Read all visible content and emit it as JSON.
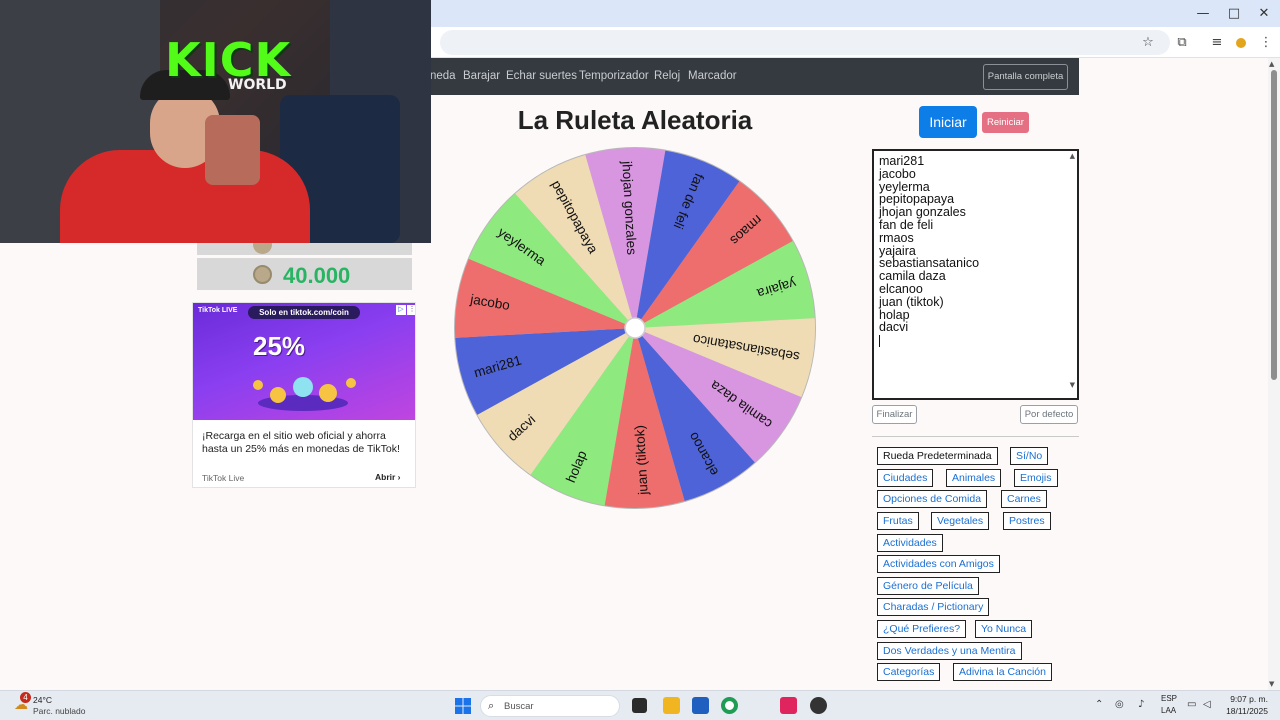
{
  "browser": {
    "window_controls": {
      "minimize": "—",
      "maximize": "□",
      "close": "✕"
    },
    "toolbar_icons": [
      "star-icon",
      "extensions-icon",
      "media-icon",
      "profile-icon",
      "menu-icon"
    ]
  },
  "navbar": {
    "links": [
      "neda",
      "Barajar",
      "Echar suertes",
      "Temporizador",
      "Reloj",
      "Marcador"
    ],
    "fullscreen_label": "Pantalla completa"
  },
  "webcam": {
    "logo_text": "KICK",
    "logo_sub": "WORLD"
  },
  "sidebar_widget": {
    "coin_value": "40.000"
  },
  "ad": {
    "brand": "TikTok LIVE",
    "promo": "Solo en tiktok.com/coin",
    "big_text": "25%",
    "headline": "¡Recarga en el sitio web oficial y ahorra hasta un 25% más en monedas de TikTok!",
    "source": "TikTok Live",
    "cta": "Abrir"
  },
  "main": {
    "title": "La Ruleta Aleatoria",
    "start_label": "Iniciar",
    "reset_label": "Reiniciar"
  },
  "wheel": {
    "names": [
      "mari281",
      "jacobo",
      "yeylerma",
      "pepitopapaya",
      "jhojan gonzales",
      "fan de feli",
      "rmaos",
      "yajaira",
      "sebastiansatanico",
      "camila daza",
      "elcanoo",
      "juan (tiktok)",
      "holap",
      "dacvi"
    ],
    "colors": [
      "#4f63d8",
      "#ee6d6d",
      "#8ee97f",
      "#f0dcb4",
      "#d896e0",
      "#4f63d8",
      "#ee6d6d",
      "#8ee97f",
      "#f0dcb4",
      "#d896e0",
      "#4f63d8",
      "#ee6d6d",
      "#8ee97f",
      "#f0dcb4"
    ],
    "pointer_color": "#e01818"
  },
  "names_box": {
    "entries": [
      "mari281",
      "jacobo",
      "yeylerma",
      "pepitopapaya",
      "jhojan gonzales",
      "fan de feli",
      "rmaos",
      "yajaira",
      "sebastiansatanico",
      "camila daza",
      "elcanoo",
      "juan (tiktok)",
      "holap",
      "dacvi"
    ]
  },
  "controls": {
    "finalize_label": "Finalizar",
    "default_label": "Por defecto"
  },
  "presets": [
    "Rueda Predeterminada",
    "Sí/No",
    "Ciudades",
    "Animales",
    "Emojis",
    "Opciones de Comida",
    "Carnes",
    "Frutas",
    "Vegetales",
    "Postres",
    "Actividades",
    "Actividades con Amigos",
    "Género de Película",
    "Charadas / Pictionary",
    "¿Qué Prefieres?",
    "Yo Nunca",
    "Dos Verdades y una Mentira",
    "Categorías",
    "Adivina la Canción"
  ],
  "taskbar": {
    "weather_badge": "4",
    "temperature": "24°C",
    "weather": "Parc. nublado",
    "search_placeholder": "Buscar",
    "lang_1": "ESP",
    "lang_2": "LAA",
    "time": "9:07 p. m.",
    "date": "18/11/2025"
  }
}
